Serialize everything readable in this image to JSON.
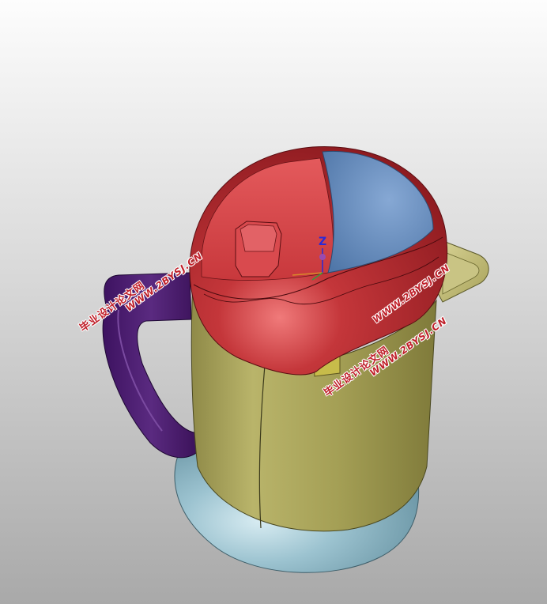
{
  "viewport": {
    "background_top": "#fdfdfd",
    "background_bottom": "#a9a9a9"
  },
  "model": {
    "parts": [
      {
        "name": "lid",
        "color": "#b8282c"
      },
      {
        "name": "lid-button",
        "color": "#6e93c4"
      },
      {
        "name": "body",
        "color": "#a9a45a"
      },
      {
        "name": "handle",
        "color": "#4a1c6e"
      },
      {
        "name": "base",
        "color": "#8fb7c6"
      },
      {
        "name": "spout",
        "color": "#c8c27a"
      },
      {
        "name": "switch",
        "color": "#bfb44a"
      }
    ]
  },
  "axis": {
    "label": "Z"
  },
  "watermarks": [
    {
      "line1": "毕业设计论文网",
      "line2": "WWW.2BYSJ.CN"
    },
    {
      "line1": "毕业设计论文网",
      "line2": "WWW.2BYSJ.CN"
    },
    {
      "line1": "毕业设计论文网",
      "line2": "WWW.2BYSJ.CN"
    }
  ]
}
